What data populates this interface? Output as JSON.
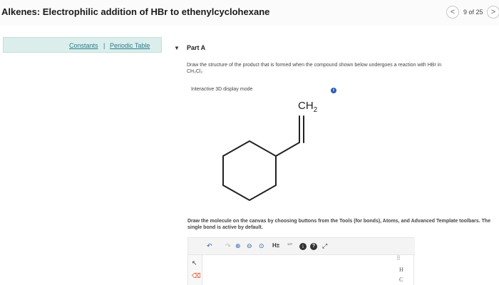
{
  "header": {
    "title": "Alkenes: Electrophilic addition of HBr to ethenylcyclohexane",
    "pager": "9 of 25",
    "prev_glyph": "<",
    "next_glyph": ">"
  },
  "resources": {
    "constants": "Constants",
    "separator": "|",
    "periodic_table": "Periodic Table"
  },
  "part": {
    "toggle_glyph": "▼",
    "title": "Part A",
    "question": "Draw the structure of the product that is formed when the compound shown below undergoes a reaction with HBr in",
    "solvent": "CH₂Cl₂",
    "display_mode": "Interactive 3D display mode",
    "info_glyph": "i"
  },
  "molecule": {
    "label_main": "CH",
    "label_sub": "2"
  },
  "instructions": "Draw the molecule on the canvas by choosing buttons from the Tools (for bonds), Atoms, and Advanced Template toolbars. The single bond is active by default.",
  "toolbar": {
    "undo_glyph": "↶",
    "redo_glyph": "↷",
    "zoom_in_glyph": "⊕",
    "zoom_out_glyph": "⊖",
    "fit_glyph": "⊙",
    "h_label": "H±",
    "iso_label": "¹²⁰",
    "info_glyph": "i",
    "help_glyph": "?",
    "expand_glyph": "⤢"
  },
  "left_tools": {
    "select_glyph": "↖",
    "erase_glyph": "⌫"
  },
  "right_tools": {
    "grid_glyph": "⠿",
    "h_label": "H",
    "c_label": "C"
  }
}
